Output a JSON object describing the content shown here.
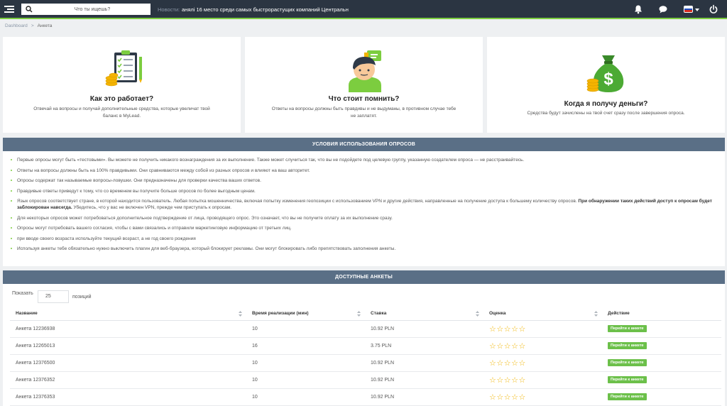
{
  "topbar": {
    "search_placeholder": "Что ты ищешь?",
    "news_label": "Новости:",
    "news_text": "анялі 16 место среди самых быстрорастущих компаний Центральн"
  },
  "breadcrumb": {
    "home": "Dashboard",
    "separator": ">",
    "current": "Анкета"
  },
  "cards": [
    {
      "title": "Как это работает?",
      "text": "Отвечай на вопросы и получай дополнительные средства, которые увеличат твой баланс в MyLead."
    },
    {
      "title": "Что стоит помнить?",
      "text": "Ответы на вопросы должны быть правдивы и не выдуманы, в противном случае тебе не заплатят."
    },
    {
      "title": "Когда я получу деньги?",
      "text": "Средства будут зачислены на твой счет сразу после завершения опроса."
    }
  ],
  "rules": {
    "heading": "УСЛОВИЯ ИСПОЛЬЗОВАНИЯ ОПРОСОВ",
    "items": [
      "Первые опросы могут быть «тестовыми». Вы можете не получить никакого вознаграждения за их выполнение. Также может случиться так, что вы не подойдете под целевую группу, указанную создателем опроса — не расстраивайтесь.",
      "Ответы на вопросы должны быть на 100% правдивыми. Они сравниваются между собой из разных опросов и влияют на ваш авторитет.",
      "Опросы содержат так называемые вопросы-ловушки. Они предназначены для проверки качества ваших ответов.",
      "Правдивые ответы приведут к тому, что со временем вы получите больше опросов по более выгодным ценам.",
      "Язык опросов соответствует стране, в которой находится пользователь. Любая попытка мошенничества, включая попытку изменения геопозиции с использованием VPN и другие действия, направленные на получение доступа к большему количеству опросов.",
      "Для некоторых опросов может потребоваться дополнительное подтверждение от лица, проводящего опрос. Это означает, что вы не получите оплату за их выполнение сразу.",
      "Опросы могут потребовать вашего согласия, чтобы с вами связались и отправили маркетинговую информацию от третьих лиц.",
      "при вводе своего возраста используйте текущий возраст, а не год своего рождения",
      "Используя анкеты тебе обязательно нужно выключить плагин для веб-браузера, который блокирует рекламы. Они могут блокировать либо препятствовать заполнения анкеты."
    ],
    "item5_bold": "При обнаружении таких действий доступ к опросам будет заблокирован навсегда.",
    "item5_tail": "Убедитесь, что у вас не включен VPN, прежде чем приступать к опросам."
  },
  "surveys": {
    "heading": "ДОСТУПНЫЕ АНКЕТЫ",
    "show_label": "Показать",
    "show_value": "25",
    "show_suffix": "позиций",
    "columns": [
      "Название",
      "Время реализации (мин)",
      "Ставка",
      "Оценка",
      "Действие"
    ],
    "button_label": "Перейти к анкете",
    "rows": [
      {
        "name": "Анкета 12236938",
        "time": "10",
        "rate": "10.92 PLN",
        "rating": 5
      },
      {
        "name": "Анкета 12265013",
        "time": "16",
        "rate": "3.75 PLN",
        "rating": 5
      },
      {
        "name": "Анкета 12376500",
        "time": "10",
        "rate": "10.92 PLN",
        "rating": 5
      },
      {
        "name": "Анкета 12376352",
        "time": "10",
        "rate": "10.92 PLN",
        "rating": 5
      },
      {
        "name": "Анкета 12376353",
        "time": "10",
        "rate": "10.92 PLN",
        "rating": 5
      }
    ]
  },
  "colors": {
    "topbar": "#2b3542",
    "accent": "#7ccd3f",
    "panel_header": "#5a6f86",
    "button": "#6cc04a",
    "star": "#f0b400"
  }
}
